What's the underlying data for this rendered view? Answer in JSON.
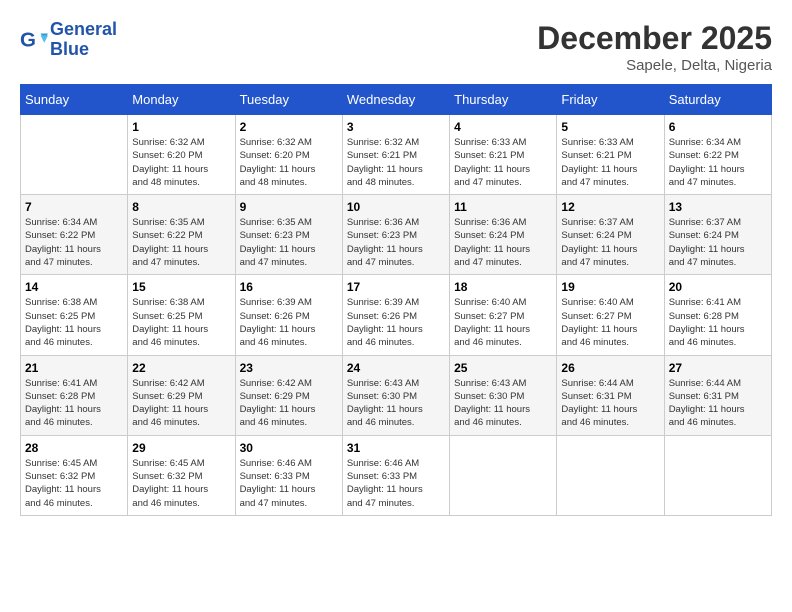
{
  "logo": {
    "line1": "General",
    "line2": "Blue"
  },
  "title": "December 2025",
  "location": "Sapele, Delta, Nigeria",
  "days_header": [
    "Sunday",
    "Monday",
    "Tuesday",
    "Wednesday",
    "Thursday",
    "Friday",
    "Saturday"
  ],
  "weeks": [
    [
      {
        "num": "",
        "info": ""
      },
      {
        "num": "1",
        "info": "Sunrise: 6:32 AM\nSunset: 6:20 PM\nDaylight: 11 hours\nand 48 minutes."
      },
      {
        "num": "2",
        "info": "Sunrise: 6:32 AM\nSunset: 6:20 PM\nDaylight: 11 hours\nand 48 minutes."
      },
      {
        "num": "3",
        "info": "Sunrise: 6:32 AM\nSunset: 6:21 PM\nDaylight: 11 hours\nand 48 minutes."
      },
      {
        "num": "4",
        "info": "Sunrise: 6:33 AM\nSunset: 6:21 PM\nDaylight: 11 hours\nand 47 minutes."
      },
      {
        "num": "5",
        "info": "Sunrise: 6:33 AM\nSunset: 6:21 PM\nDaylight: 11 hours\nand 47 minutes."
      },
      {
        "num": "6",
        "info": "Sunrise: 6:34 AM\nSunset: 6:22 PM\nDaylight: 11 hours\nand 47 minutes."
      }
    ],
    [
      {
        "num": "7",
        "info": "Sunrise: 6:34 AM\nSunset: 6:22 PM\nDaylight: 11 hours\nand 47 minutes."
      },
      {
        "num": "8",
        "info": "Sunrise: 6:35 AM\nSunset: 6:22 PM\nDaylight: 11 hours\nand 47 minutes."
      },
      {
        "num": "9",
        "info": "Sunrise: 6:35 AM\nSunset: 6:23 PM\nDaylight: 11 hours\nand 47 minutes."
      },
      {
        "num": "10",
        "info": "Sunrise: 6:36 AM\nSunset: 6:23 PM\nDaylight: 11 hours\nand 47 minutes."
      },
      {
        "num": "11",
        "info": "Sunrise: 6:36 AM\nSunset: 6:24 PM\nDaylight: 11 hours\nand 47 minutes."
      },
      {
        "num": "12",
        "info": "Sunrise: 6:37 AM\nSunset: 6:24 PM\nDaylight: 11 hours\nand 47 minutes."
      },
      {
        "num": "13",
        "info": "Sunrise: 6:37 AM\nSunset: 6:24 PM\nDaylight: 11 hours\nand 47 minutes."
      }
    ],
    [
      {
        "num": "14",
        "info": "Sunrise: 6:38 AM\nSunset: 6:25 PM\nDaylight: 11 hours\nand 46 minutes."
      },
      {
        "num": "15",
        "info": "Sunrise: 6:38 AM\nSunset: 6:25 PM\nDaylight: 11 hours\nand 46 minutes."
      },
      {
        "num": "16",
        "info": "Sunrise: 6:39 AM\nSunset: 6:26 PM\nDaylight: 11 hours\nand 46 minutes."
      },
      {
        "num": "17",
        "info": "Sunrise: 6:39 AM\nSunset: 6:26 PM\nDaylight: 11 hours\nand 46 minutes."
      },
      {
        "num": "18",
        "info": "Sunrise: 6:40 AM\nSunset: 6:27 PM\nDaylight: 11 hours\nand 46 minutes."
      },
      {
        "num": "19",
        "info": "Sunrise: 6:40 AM\nSunset: 6:27 PM\nDaylight: 11 hours\nand 46 minutes."
      },
      {
        "num": "20",
        "info": "Sunrise: 6:41 AM\nSunset: 6:28 PM\nDaylight: 11 hours\nand 46 minutes."
      }
    ],
    [
      {
        "num": "21",
        "info": "Sunrise: 6:41 AM\nSunset: 6:28 PM\nDaylight: 11 hours\nand 46 minutes."
      },
      {
        "num": "22",
        "info": "Sunrise: 6:42 AM\nSunset: 6:29 PM\nDaylight: 11 hours\nand 46 minutes."
      },
      {
        "num": "23",
        "info": "Sunrise: 6:42 AM\nSunset: 6:29 PM\nDaylight: 11 hours\nand 46 minutes."
      },
      {
        "num": "24",
        "info": "Sunrise: 6:43 AM\nSunset: 6:30 PM\nDaylight: 11 hours\nand 46 minutes."
      },
      {
        "num": "25",
        "info": "Sunrise: 6:43 AM\nSunset: 6:30 PM\nDaylight: 11 hours\nand 46 minutes."
      },
      {
        "num": "26",
        "info": "Sunrise: 6:44 AM\nSunset: 6:31 PM\nDaylight: 11 hours\nand 46 minutes."
      },
      {
        "num": "27",
        "info": "Sunrise: 6:44 AM\nSunset: 6:31 PM\nDaylight: 11 hours\nand 46 minutes."
      }
    ],
    [
      {
        "num": "28",
        "info": "Sunrise: 6:45 AM\nSunset: 6:32 PM\nDaylight: 11 hours\nand 46 minutes."
      },
      {
        "num": "29",
        "info": "Sunrise: 6:45 AM\nSunset: 6:32 PM\nDaylight: 11 hours\nand 46 minutes."
      },
      {
        "num": "30",
        "info": "Sunrise: 6:46 AM\nSunset: 6:33 PM\nDaylight: 11 hours\nand 47 minutes."
      },
      {
        "num": "31",
        "info": "Sunrise: 6:46 AM\nSunset: 6:33 PM\nDaylight: 11 hours\nand 47 minutes."
      },
      {
        "num": "",
        "info": ""
      },
      {
        "num": "",
        "info": ""
      },
      {
        "num": "",
        "info": ""
      }
    ]
  ]
}
